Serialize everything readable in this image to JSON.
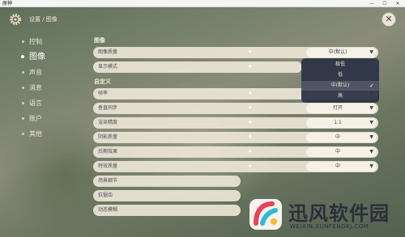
{
  "window": {
    "title": "原神",
    "minimize": "—",
    "maximize": "☐",
    "close": "✕"
  },
  "header": {
    "breadcrumb": "设置 / 图像",
    "close_label": "✕"
  },
  "nav": {
    "items": [
      {
        "label": "控制"
      },
      {
        "label": "图像"
      },
      {
        "label": "声音"
      },
      {
        "label": "消息"
      },
      {
        "label": "语言"
      },
      {
        "label": "账户"
      },
      {
        "label": "其他"
      }
    ],
    "active": "图像"
  },
  "sections": {
    "image": "图像",
    "custom": "自定义"
  },
  "rows": [
    {
      "label": "图像质量",
      "value": "中(默认)"
    },
    {
      "label": "显示模式",
      "value": ""
    },
    {
      "label": "帧率",
      "value": ""
    },
    {
      "label": "垂直同步",
      "value": "打开"
    },
    {
      "label": "渲染精度",
      "value": "1.1"
    },
    {
      "label": "阴影质量",
      "value": "中"
    },
    {
      "label": "后期效果",
      "value": "中"
    },
    {
      "label": "特效质量",
      "value": "中"
    },
    {
      "label": "场景细节",
      "value": ""
    },
    {
      "label": "抗锯齿",
      "value": ""
    },
    {
      "label": "动态模糊",
      "value": ""
    }
  ],
  "dropdown": {
    "options": [
      "极低",
      "低",
      "中(默认)",
      "高"
    ],
    "selected": "中(默认)",
    "check": "✓"
  },
  "watermark": {
    "name": "迅风软件园",
    "url": "WEIXIN.XUNFENGKJ.COM"
  }
}
